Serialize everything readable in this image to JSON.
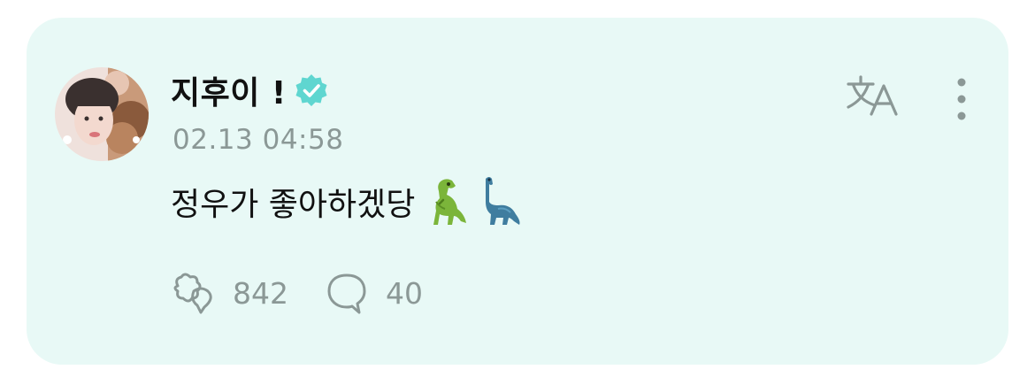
{
  "post": {
    "author_name": "지후이 !",
    "timestamp": "02.13 04:58",
    "text": "정우가 좋아하겠당",
    "emojis": [
      "t-rex-emoji",
      "sauropod-emoji"
    ],
    "stats": {
      "likes_count": "842",
      "comments_count": "40"
    }
  },
  "icons": {
    "verified": "verified-badge-icon",
    "translate": "translate-icon",
    "more": "more-vertical-icon",
    "like": "sparkle-heart-icon",
    "comment": "speech-bubble-icon"
  },
  "colors": {
    "card_background": "#e8f9f6",
    "accent_verified": "#5fd6d0",
    "icon_gray": "#8b9896",
    "text_primary": "#111111"
  }
}
